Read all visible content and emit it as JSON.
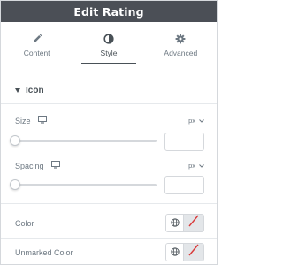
{
  "header": {
    "title": "Edit Rating"
  },
  "tabs": [
    {
      "label": "Content",
      "icon": "pencil-icon",
      "active": false
    },
    {
      "label": "Style",
      "icon": "half-circle-icon",
      "active": true
    },
    {
      "label": "Advanced",
      "icon": "gear-icon",
      "active": false
    }
  ],
  "section": {
    "title": "Icon",
    "expanded": true
  },
  "controls": {
    "size": {
      "label": "Size",
      "unit": "px",
      "value": "",
      "slider_fraction": 0
    },
    "spacing": {
      "label": "Spacing",
      "unit": "px",
      "value": "",
      "slider_fraction": 0
    },
    "color": {
      "label": "Color"
    },
    "unmarked_color": {
      "label": "Unmarked Color"
    }
  },
  "colors": {
    "header_bg": "#4b4f56",
    "active_tab": "#495157",
    "clear_slash": "#d93a3a"
  }
}
